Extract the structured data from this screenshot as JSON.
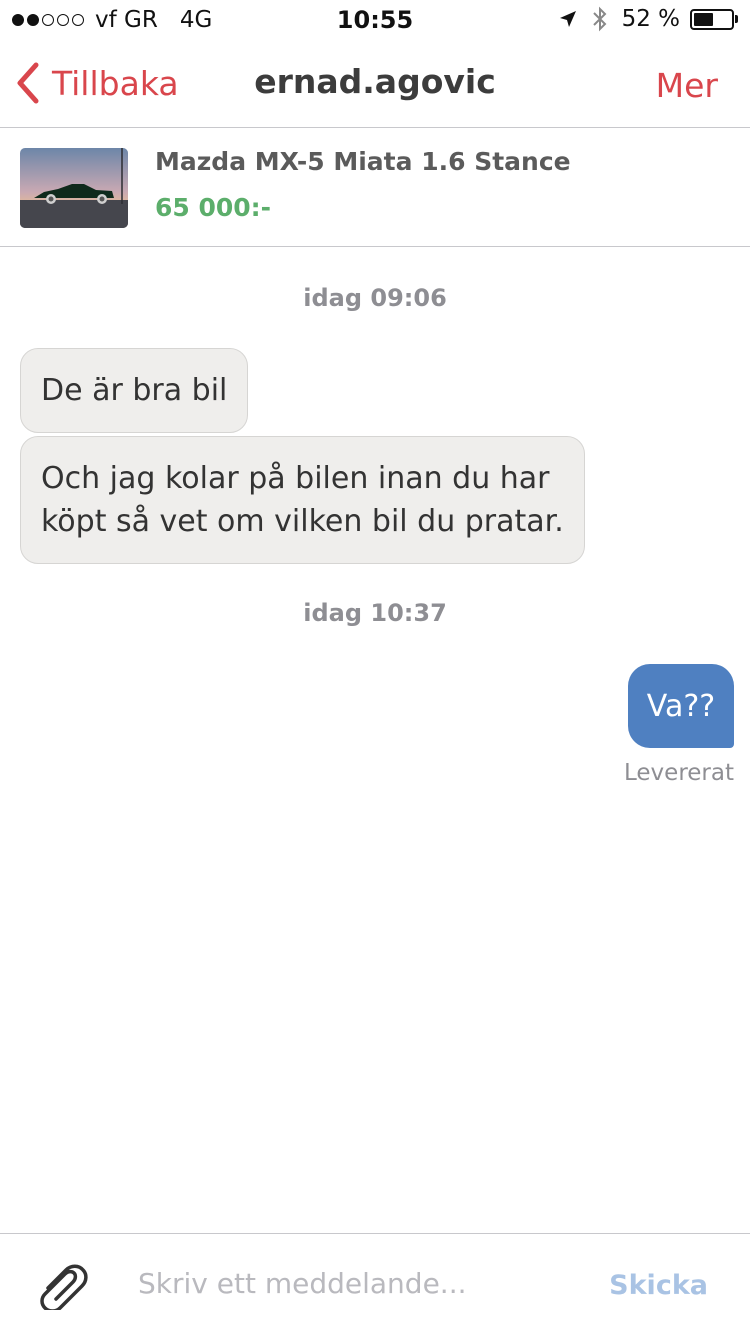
{
  "status_bar": {
    "carrier": "vf GR",
    "network": "4G",
    "time": "10:55",
    "battery": "52 %",
    "battery_level": 0.52,
    "signal_bars_filled": 2,
    "signal_bars_total": 5
  },
  "nav": {
    "back_label": "Tillbaka",
    "title": "ernad.agovic",
    "more_label": "Mer"
  },
  "listing": {
    "title": "Mazda MX-5 Miata 1.6 Stance",
    "price": "65 000:-"
  },
  "messages": {
    "timestamp_1": "idag 09:06",
    "incoming_1": "De är bra bil",
    "incoming_2_line1": "Och jag kolar på bilen inan du har",
    "incoming_2_line2": "köpt så vet om vilken bil du pratar.",
    "timestamp_2": "idag 10:37",
    "outgoing_1": "Va??",
    "outgoing_1_status": "Levererat"
  },
  "composer": {
    "placeholder": "Skriv ett meddelande...",
    "send_label": "Skicka"
  },
  "colors": {
    "accent": "#d9464c",
    "price": "#5cae6b",
    "outgoing_bubble": "#4f80c1",
    "incoming_bubble": "#efeeec",
    "send_disabled": "#a9c3e4"
  },
  "icons": {
    "back": "chevron-left-icon",
    "location": "location-arrow-icon",
    "bluetooth": "bluetooth-icon",
    "battery": "battery-icon",
    "attach": "paperclip-icon"
  }
}
